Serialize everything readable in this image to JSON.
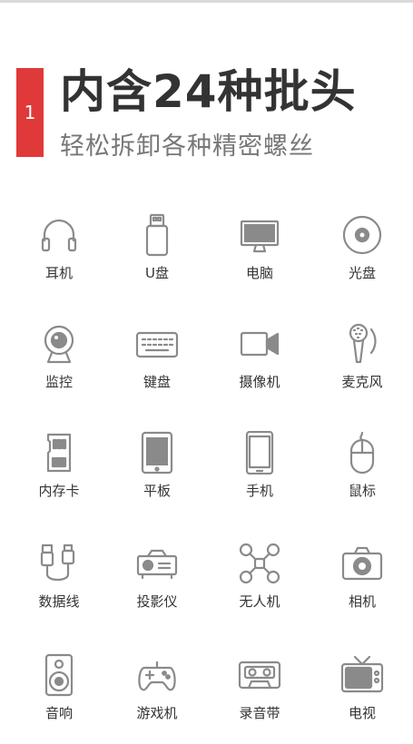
{
  "header": {
    "badge_number": "1",
    "title": "内含24种批头",
    "subtitle": "轻松拆卸各种精密螺丝"
  },
  "colors": {
    "accent": "#e0393a",
    "icon_stroke": "#8a8a8a",
    "text": "#333333"
  },
  "items": [
    {
      "label": "耳机",
      "icon": "headphones-icon"
    },
    {
      "label": "U盘",
      "icon": "usb-drive-icon"
    },
    {
      "label": "电脑",
      "icon": "monitor-icon"
    },
    {
      "label": "光盘",
      "icon": "disc-icon"
    },
    {
      "label": "监控",
      "icon": "webcam-icon"
    },
    {
      "label": "键盘",
      "icon": "keyboard-icon"
    },
    {
      "label": "摄像机",
      "icon": "video-camera-icon"
    },
    {
      "label": "麦克风",
      "icon": "microphone-icon"
    },
    {
      "label": "内存卡",
      "icon": "memory-card-icon"
    },
    {
      "label": "平板",
      "icon": "tablet-icon"
    },
    {
      "label": "手机",
      "icon": "phone-icon"
    },
    {
      "label": "鼠标",
      "icon": "mouse-icon"
    },
    {
      "label": "数据线",
      "icon": "cable-icon"
    },
    {
      "label": "投影仪",
      "icon": "projector-icon"
    },
    {
      "label": "无人机",
      "icon": "drone-icon"
    },
    {
      "label": "相机",
      "icon": "camera-icon"
    },
    {
      "label": "音响",
      "icon": "speaker-icon"
    },
    {
      "label": "游戏机",
      "icon": "gamepad-icon"
    },
    {
      "label": "录音带",
      "icon": "cassette-icon"
    },
    {
      "label": "电视",
      "icon": "tv-icon"
    }
  ]
}
